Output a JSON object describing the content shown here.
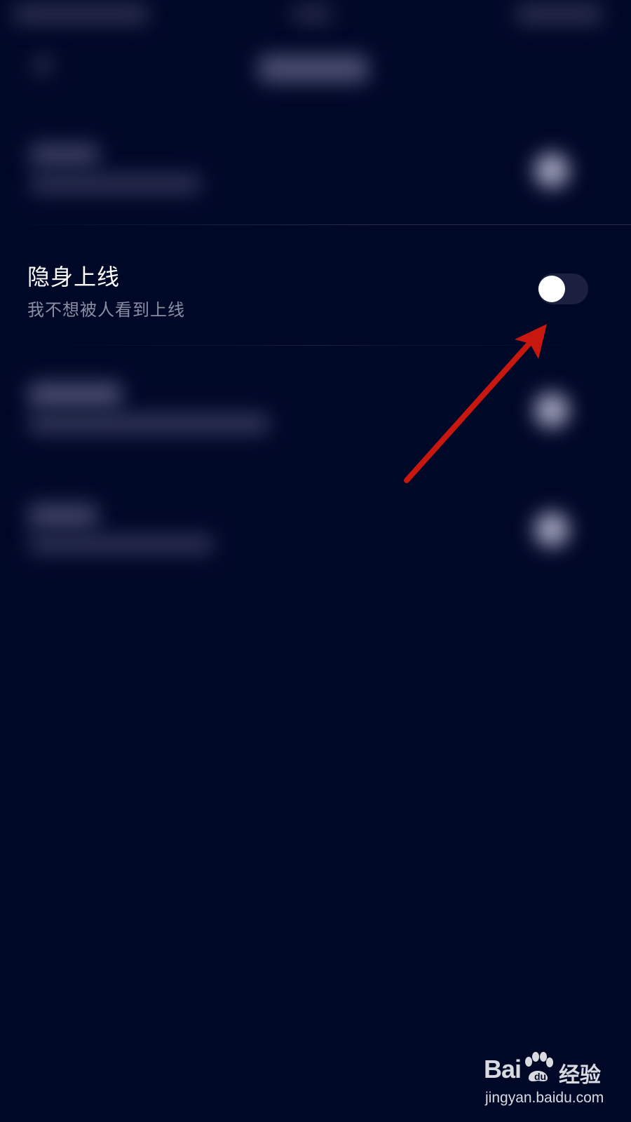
{
  "setting": {
    "title": "隐身上线",
    "subtitle": "我不想被人看到上线",
    "toggle_on": false
  },
  "watermark": {
    "logo_text": "Bai",
    "logo_cn": "经验",
    "url": "jingyan.baidu.com"
  },
  "colors": {
    "background": "#000828",
    "annotation_arrow": "#c8170f",
    "toggle_track": "#1b2040",
    "toggle_knob": "#ffffff",
    "subtitle_text": "#8b8ea3"
  }
}
